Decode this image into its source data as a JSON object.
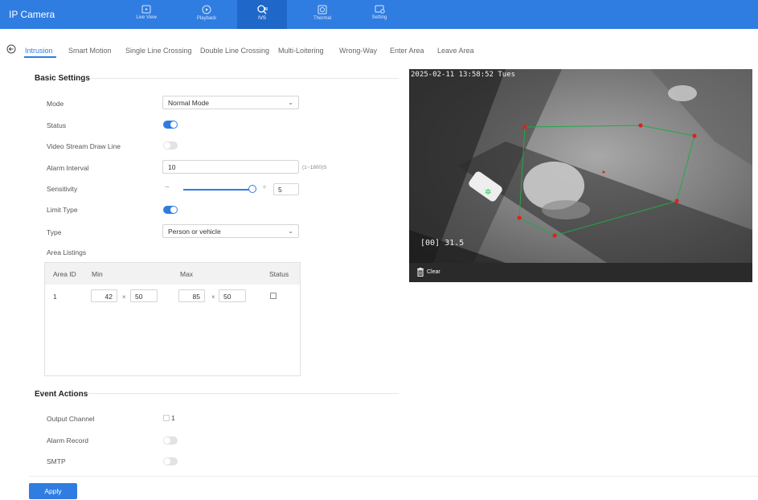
{
  "app": {
    "title": "IP Camera"
  },
  "nav": [
    {
      "label": "Live View",
      "icon": "live-view-icon"
    },
    {
      "label": "Playback",
      "icon": "playback-icon"
    },
    {
      "label": "IVS",
      "icon": "ivs-icon",
      "active": true
    },
    {
      "label": "Thermal",
      "icon": "thermal-icon"
    },
    {
      "label": "Setting",
      "icon": "setting-icon"
    }
  ],
  "tabs": [
    "Intrusion",
    "Smart Motion",
    "Single Line Crossing",
    "Double Line Crossing",
    "Multi-Loitering",
    "Wrong-Way",
    "Enter Area",
    "Leave Area"
  ],
  "active_tab": "Intrusion",
  "basic": {
    "title": "Basic Settings",
    "mode_label": "Mode",
    "mode_value": "Normal Mode",
    "status_label": "Status",
    "status_on": true,
    "draw_line_label": "Video Stream Draw Line",
    "draw_line_on": false,
    "alarm_interval_label": "Alarm Interval",
    "alarm_interval_value": "10",
    "alarm_interval_hint": "(1~1800)S",
    "sensitivity_label": "Sensitivity",
    "sensitivity_value": "5",
    "sensitivity_minus": "−",
    "sensitivity_plus": "+",
    "limit_type_label": "Limit Type",
    "limit_type_on": true,
    "type_label": "Type",
    "type_value": "Person or vehicle",
    "area_listings_label": "Area Listings"
  },
  "area_table": {
    "headers": [
      "Area ID",
      "Min",
      "Max",
      "Status"
    ],
    "rows": [
      {
        "id": "1",
        "min_w": "42",
        "min_h": "50",
        "max_w": "85",
        "max_h": "50",
        "status": false
      }
    ],
    "x_symbol": "×"
  },
  "events": {
    "title": "Event Actions",
    "output_channel_label": "Output Channel",
    "output_channel_value": "1",
    "alarm_record_label": "Alarm Record",
    "alarm_record_on": false,
    "smtp_label": "SMTP",
    "smtp_on": false
  },
  "video": {
    "timestamp": "2025-02-11 13:58:52 Tues",
    "overlay_text": "[00] 31.5",
    "clear_label": "Clear"
  },
  "apply_label": "Apply",
  "colors": {
    "primary": "#2f7de1",
    "zone_line": "#22a84a",
    "zone_point": "#e02020"
  }
}
